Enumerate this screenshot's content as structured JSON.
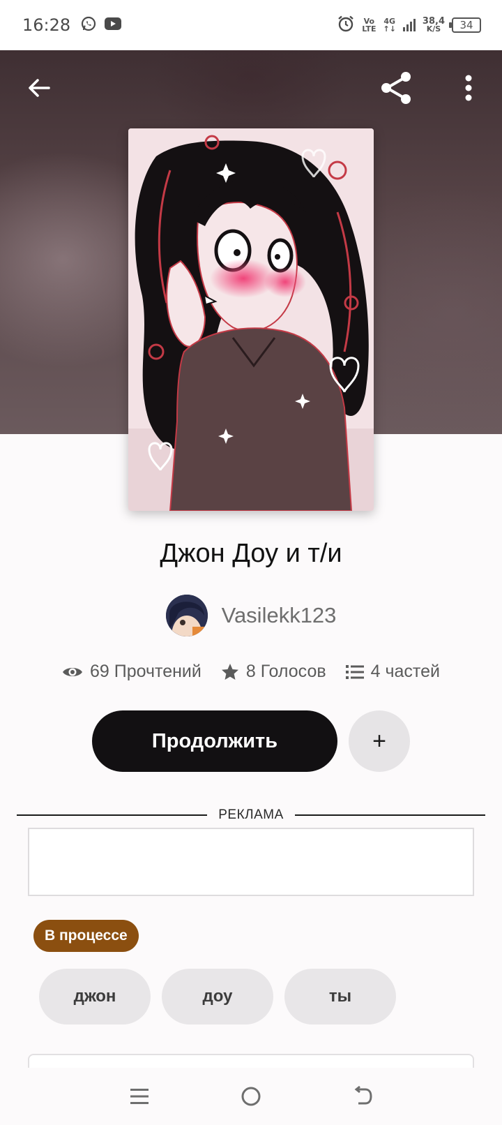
{
  "status_bar": {
    "time": "16:28",
    "volte_top": "Vo",
    "volte_bottom": "LTE",
    "network_top": "4G",
    "network_bottom": "↑↓",
    "speed_value": "38,4",
    "speed_unit": "K/S",
    "battery": "34",
    "icons": [
      "whatsapp-icon",
      "youtube-icon",
      "alarm-icon",
      "signal-icon"
    ]
  },
  "toolbar": {
    "back_icon": "arrow-left-icon",
    "share_icon": "share-icon",
    "more_icon": "more-vertical-icon"
  },
  "story": {
    "title": "Джон Доу и т/и",
    "author": "Vasilekk123",
    "stats": {
      "reads": "69 Прочтений",
      "votes": "8 Голосов",
      "parts": "4 частей"
    },
    "continue_label": "Продолжить",
    "add_label": "+",
    "status_badge": "В процессе",
    "tags": [
      "джон",
      "доу",
      "ты"
    ]
  },
  "ad": {
    "label": "РЕКЛАМА"
  },
  "colors": {
    "primary_button": "#121012",
    "status_badge": "#8b4f10",
    "tag_bg": "#e8e6e8",
    "hero_bg": "#564346"
  }
}
